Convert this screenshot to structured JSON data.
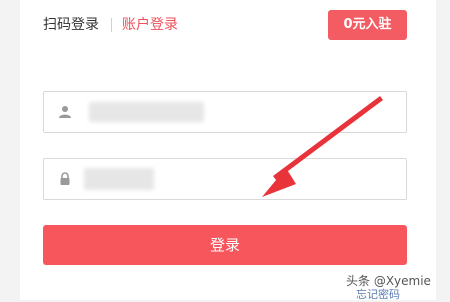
{
  "tabs": {
    "scan_login": "扫码登录",
    "account_login": "账户登录"
  },
  "join_button": "0元入驻",
  "username": {
    "icon": "user-icon",
    "value": ""
  },
  "password": {
    "icon": "lock-icon",
    "value": ""
  },
  "login_button": "登录",
  "forgot_password": "忘记密码",
  "watermark": "头条 @Xyemie",
  "colors": {
    "accent": "#f8565d",
    "active_tab": "#f0505a",
    "arrow": "#e8333a"
  }
}
